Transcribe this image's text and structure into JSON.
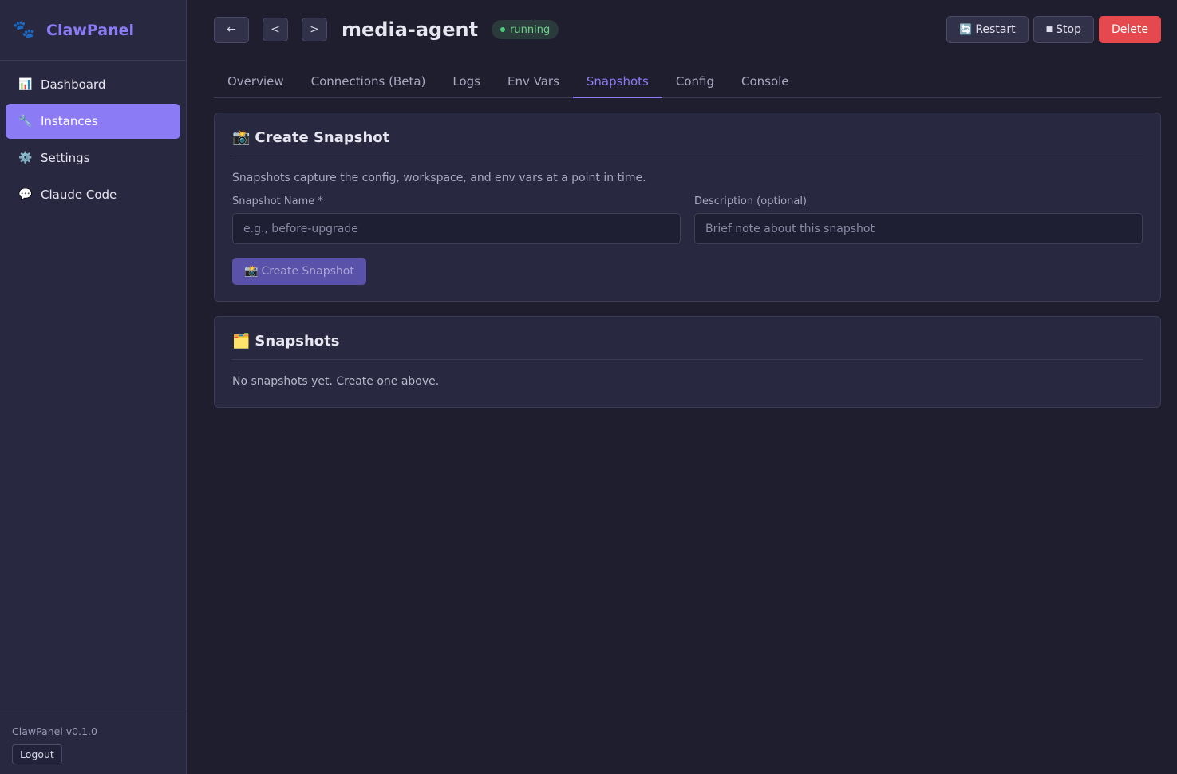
{
  "brand": {
    "title": "ClawPanel",
    "icon": "paw-icon"
  },
  "sidebar": {
    "items": [
      {
        "label": "Dashboard",
        "icon": "bar-chart-icon",
        "glyph": "📊",
        "active": false
      },
      {
        "label": "Instances",
        "icon": "wrench-icon",
        "glyph": "🔧",
        "active": true
      },
      {
        "label": "Settings",
        "icon": "gear-icon",
        "glyph": "⚙️",
        "active": false
      },
      {
        "label": "Claude Code",
        "icon": "speech-bubble-icon",
        "glyph": "💬",
        "active": false
      }
    ],
    "version": "ClawPanel v0.1.0",
    "logout_label": "Logout"
  },
  "header": {
    "back_label": "←",
    "prev_label": "<",
    "next_label": ">",
    "title": "media-agent",
    "status": "running",
    "restart_label": "Restart",
    "stop_label": "Stop",
    "delete_label": "Delete"
  },
  "tabs": [
    {
      "label": "Overview",
      "active": false
    },
    {
      "label": "Connections (Beta)",
      "active": false
    },
    {
      "label": "Logs",
      "active": false
    },
    {
      "label": "Env Vars",
      "active": false
    },
    {
      "label": "Snapshots",
      "active": true
    },
    {
      "label": "Config",
      "active": false
    },
    {
      "label": "Console",
      "active": false
    }
  ],
  "create_card": {
    "title": "Create Snapshot",
    "description": "Snapshots capture the config, workspace, and env vars at a point in time.",
    "name_label": "Snapshot Name *",
    "name_placeholder": "e.g., before-upgrade",
    "name_value": "",
    "desc_label": "Description (optional)",
    "desc_placeholder": "Brief note about this snapshot",
    "desc_value": "",
    "button_label": "Create Snapshot"
  },
  "list_card": {
    "title": "Snapshots",
    "empty_text": "No snapshots yet. Create one above."
  },
  "colors": {
    "accent": "#8b7cf6",
    "danger": "#e5484d",
    "success": "#4cd07d",
    "background": "#1e1e2e",
    "panel": "#282840"
  }
}
